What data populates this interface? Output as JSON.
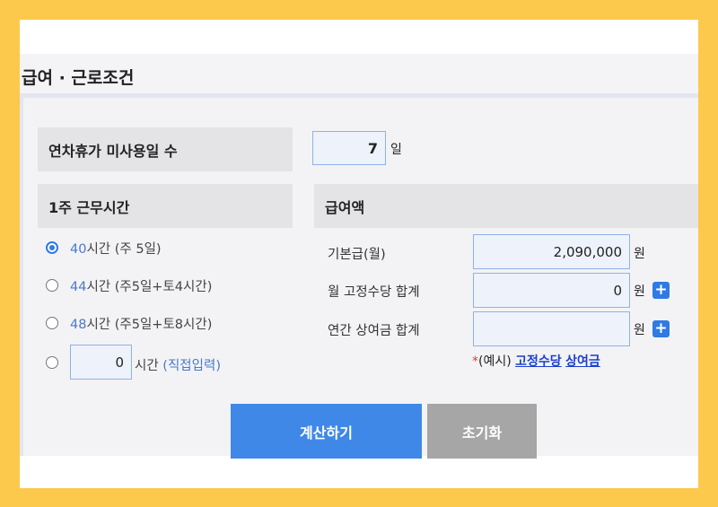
{
  "title": "급여 · 근로조건",
  "leave": {
    "label": "연차휴가 미사용일 수",
    "value": "7",
    "unit": "일"
  },
  "hours": {
    "header": "1주 근무시간",
    "options": [
      {
        "hours": "40",
        "text": "시간 (주 5일)",
        "checked": true
      },
      {
        "hours": "44",
        "text": "시간 (주5일+토4시간)",
        "checked": false
      },
      {
        "hours": "48",
        "text": "시간 (주5일+토8시간)",
        "checked": false
      }
    ],
    "custom_value": "0",
    "custom_unit": "시간",
    "custom_hint": "(직접입력)"
  },
  "pay": {
    "header": "급여액",
    "rows": [
      {
        "label": "기본급(월)",
        "value": "2,090,000",
        "unit": "원"
      },
      {
        "label": "월 고정수당 합계",
        "value": "0",
        "unit": "원"
      },
      {
        "label": "연간 상여금 합계",
        "value": "",
        "unit": "원"
      }
    ],
    "plus_symbol": "+",
    "note_star": "*",
    "note_prefix": "(예시)",
    "note_link1": "고정수당",
    "note_link2": "상여금"
  },
  "buttons": {
    "calculate": "계산하기",
    "reset": "초기화"
  },
  "colors": {
    "frame": "#fdc94c",
    "accent": "#3f88e8",
    "reset": "#a6a6a6"
  }
}
